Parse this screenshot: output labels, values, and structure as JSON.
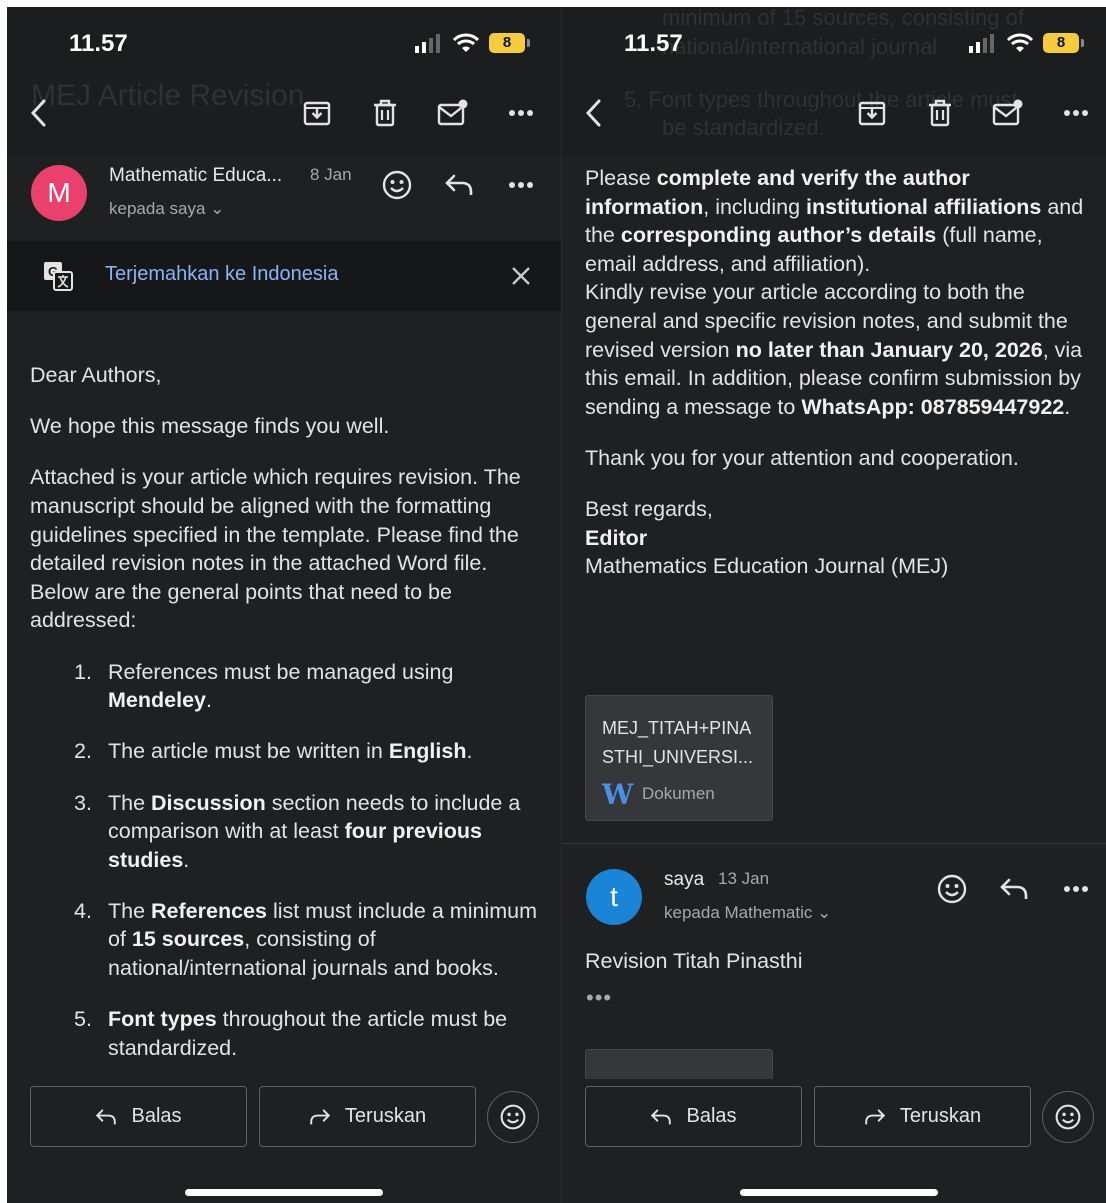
{
  "status_bar": {
    "time": "11.57",
    "battery": "8"
  },
  "left": {
    "ghost_title": "MEJ Article Revision",
    "email": {
      "sender": "Mathematic Educa...",
      "date": "8 Jan",
      "recipient": "kepada saya ⌄",
      "avatar_letter": "M",
      "avatar_color": "#e8416d"
    },
    "translate": {
      "label": "Terjemahkan ke Indonesia"
    },
    "body": {
      "greeting": "Dear Authors,",
      "intro": "We hope this message finds you well.",
      "para": "Attached is your article which requires revision. The manuscript should be aligned with the formatting guidelines specified in the template. Please find the detailed revision notes in the attached Word file. Below are the general points that need to be addressed:",
      "items": [
        {
          "num": "1.",
          "a": "References must be managed using ",
          "b": "Mendeley",
          "c": "."
        },
        {
          "num": "2.",
          "a": "The article must be written in ",
          "b": "English",
          "c": "."
        },
        {
          "num": "3.",
          "a": "The ",
          "b": "Discussion",
          "c": " section needs to include a comparison with at least ",
          "d": "four previous studies",
          "e": "."
        },
        {
          "num": "4.",
          "a": "The ",
          "b": "References",
          "c": " list must include a minimum of ",
          "d": "15 sources",
          "e": ", consisting of national/international journals and books."
        },
        {
          "num": "5.",
          "a": "",
          "b": "Font types",
          "c": " throughout the article must be standardized."
        }
      ]
    }
  },
  "right": {
    "ghost_lines": [
      "minimum of 15 sources, consisting of",
      "national/international journal",
      "5.  Font types throughout the article must",
      "be standardized."
    ],
    "body": {
      "p1_a": "Please ",
      "p1_b": "complete and verify the author information",
      "p1_c": ", including ",
      "p1_d": "institutional affiliations",
      "p1_e": " and the ",
      "p1_f": "corresponding author’s details",
      "p1_g": " (full name, email address, and affiliation).",
      "p2_a": "Kindly revise your article according to both the general and specific revision notes, and submit the revised version ",
      "p2_b": "no later than January 20, 2026",
      "p2_c": ", via this email. In addition, please confirm submission by sending a message to ",
      "p2_d": "WhatsApp: 087859447922",
      "p2_e": ".",
      "thanks": "Thank you for your attention and cooperation.",
      "regards": "Best regards,",
      "signer": "Editor",
      "journal": "Mathematics Education Journal (MEJ)"
    },
    "attachment": {
      "name": "MEJ_TITAH+PINA STHI_UNIVERSI...",
      "type": "Dokumen",
      "icon": "W"
    },
    "reply": {
      "sender": "saya",
      "date": "13 Jan",
      "recipient": "kepada Mathematic ⌄",
      "avatar_letter": "t",
      "avatar_color": "#1a84d6",
      "body": "Revision Titah Pinasthi",
      "more": "•••"
    }
  },
  "actions": {
    "reply": "Balas",
    "forward": "Teruskan"
  },
  "icons": [
    "signal-icon",
    "wifi-icon",
    "back-icon",
    "archive-icon",
    "trash-icon",
    "mark-unread-icon",
    "more-icon",
    "emoji-icon",
    "reply-icon",
    "translate-icon",
    "close-icon",
    "forward-icon",
    "word-doc-icon"
  ]
}
